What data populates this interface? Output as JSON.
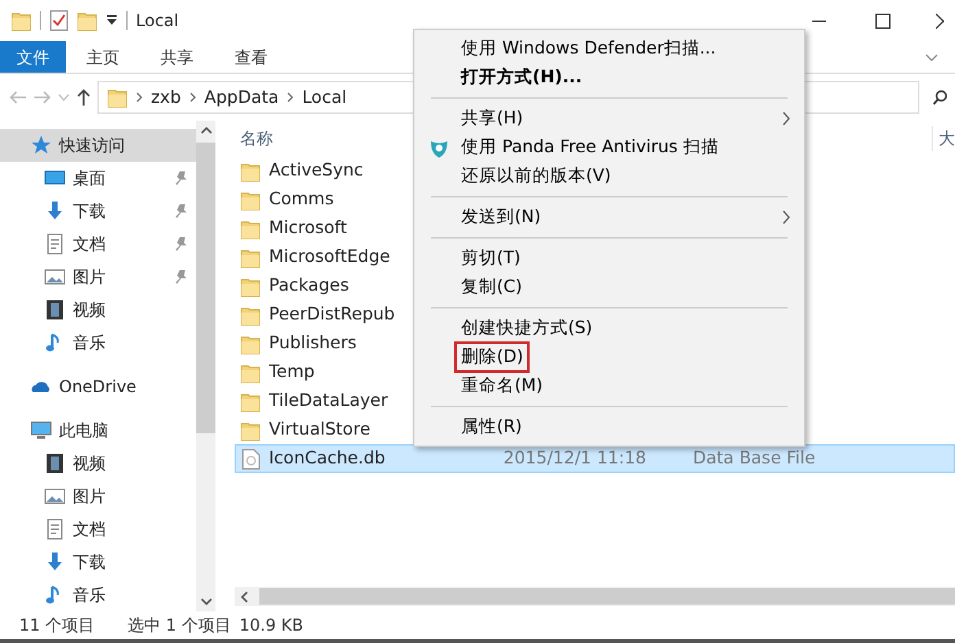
{
  "window": {
    "title": "Local"
  },
  "ribbon_tabs": [
    {
      "label": "文件",
      "kind": "file"
    },
    {
      "label": "主页",
      "kind": "tab"
    },
    {
      "label": "共享",
      "kind": "tab"
    },
    {
      "label": "查看",
      "kind": "tab"
    }
  ],
  "breadcrumbs": [
    "zxb",
    "AppData",
    "Local"
  ],
  "navigation": [
    {
      "label": "快速访问",
      "kind": "star",
      "selected": true,
      "children": [
        {
          "label": "桌面",
          "kind": "desktop",
          "pinned": true
        },
        {
          "label": "下载",
          "kind": "download",
          "pinned": true
        },
        {
          "label": "文档",
          "kind": "document",
          "pinned": true
        },
        {
          "label": "图片",
          "kind": "pictures",
          "pinned": true
        },
        {
          "label": "视频",
          "kind": "video",
          "pinned": false
        },
        {
          "label": "音乐",
          "kind": "music",
          "pinned": false
        }
      ]
    },
    {
      "label": "OneDrive",
      "kind": "cloud",
      "selected": false
    },
    {
      "label": "此电脑",
      "kind": "computer",
      "selected": false,
      "children": [
        {
          "label": "视频",
          "kind": "video",
          "pinned": false
        },
        {
          "label": "图片",
          "kind": "pictures",
          "pinned": false
        },
        {
          "label": "文档",
          "kind": "document",
          "pinned": false
        },
        {
          "label": "下载",
          "kind": "download",
          "pinned": false
        },
        {
          "label": "音乐",
          "kind": "music",
          "pinned": false
        }
      ]
    }
  ],
  "columns": [
    "名称",
    "大"
  ],
  "files": [
    {
      "name": "ActiveSync",
      "kind": "folder",
      "selected": false
    },
    {
      "name": "Comms",
      "kind": "folder",
      "selected": false
    },
    {
      "name": "Microsoft",
      "kind": "folder",
      "selected": false
    },
    {
      "name": "MicrosoftEdge",
      "kind": "folder",
      "selected": false
    },
    {
      "name": "Packages",
      "kind": "folder",
      "selected": false
    },
    {
      "name": "PeerDistRepub",
      "kind": "folder",
      "selected": false
    },
    {
      "name": "Publishers",
      "kind": "folder",
      "selected": false
    },
    {
      "name": "Temp",
      "kind": "folder",
      "selected": false
    },
    {
      "name": "TileDataLayer",
      "kind": "folder",
      "selected": false
    },
    {
      "name": "VirtualStore",
      "kind": "folder",
      "selected": false
    },
    {
      "name": "IconCache.db",
      "kind": "file",
      "selected": true,
      "date": "2015/12/1 11:18",
      "type": "Data Base File"
    }
  ],
  "context_menu": [
    {
      "kind": "item",
      "label": "使用 Windows Defender扫描...",
      "bold": false,
      "submenu": false,
      "has_icon": false,
      "highlighted": false
    },
    {
      "kind": "item",
      "label": "打开方式(H)...",
      "bold": true,
      "submenu": false,
      "has_icon": false,
      "highlighted": false
    },
    {
      "kind": "separator"
    },
    {
      "kind": "item",
      "label": "共享(H)",
      "bold": false,
      "submenu": true,
      "has_icon": false,
      "highlighted": false
    },
    {
      "kind": "item",
      "label": "使用 Panda Free Antivirus 扫描",
      "bold": false,
      "submenu": false,
      "has_icon": true,
      "highlighted": false
    },
    {
      "kind": "item",
      "label": "还原以前的版本(V)",
      "bold": false,
      "submenu": false,
      "has_icon": false,
      "highlighted": false
    },
    {
      "kind": "separator"
    },
    {
      "kind": "item",
      "label": "发送到(N)",
      "bold": false,
      "submenu": true,
      "has_icon": false,
      "highlighted": false
    },
    {
      "kind": "separator"
    },
    {
      "kind": "item",
      "label": "剪切(T)",
      "bold": false,
      "submenu": false,
      "has_icon": false,
      "highlighted": false
    },
    {
      "kind": "item",
      "label": "复制(C)",
      "bold": false,
      "submenu": false,
      "has_icon": false,
      "highlighted": false
    },
    {
      "kind": "separator"
    },
    {
      "kind": "item",
      "label": "创建快捷方式(S)",
      "bold": false,
      "submenu": false,
      "has_icon": false,
      "highlighted": false
    },
    {
      "kind": "item",
      "label": "删除(D)",
      "bold": false,
      "submenu": false,
      "has_icon": false,
      "highlighted": true
    },
    {
      "kind": "item",
      "label": "重命名(M)",
      "bold": false,
      "submenu": false,
      "has_icon": false,
      "highlighted": false
    },
    {
      "kind": "separator"
    },
    {
      "kind": "item",
      "label": "属性(R)",
      "bold": false,
      "submenu": false,
      "has_icon": false,
      "highlighted": false
    }
  ],
  "status_bar": {
    "count": "11 个项目",
    "selection": "选中 1 个项目",
    "size": "10.9 KB"
  }
}
